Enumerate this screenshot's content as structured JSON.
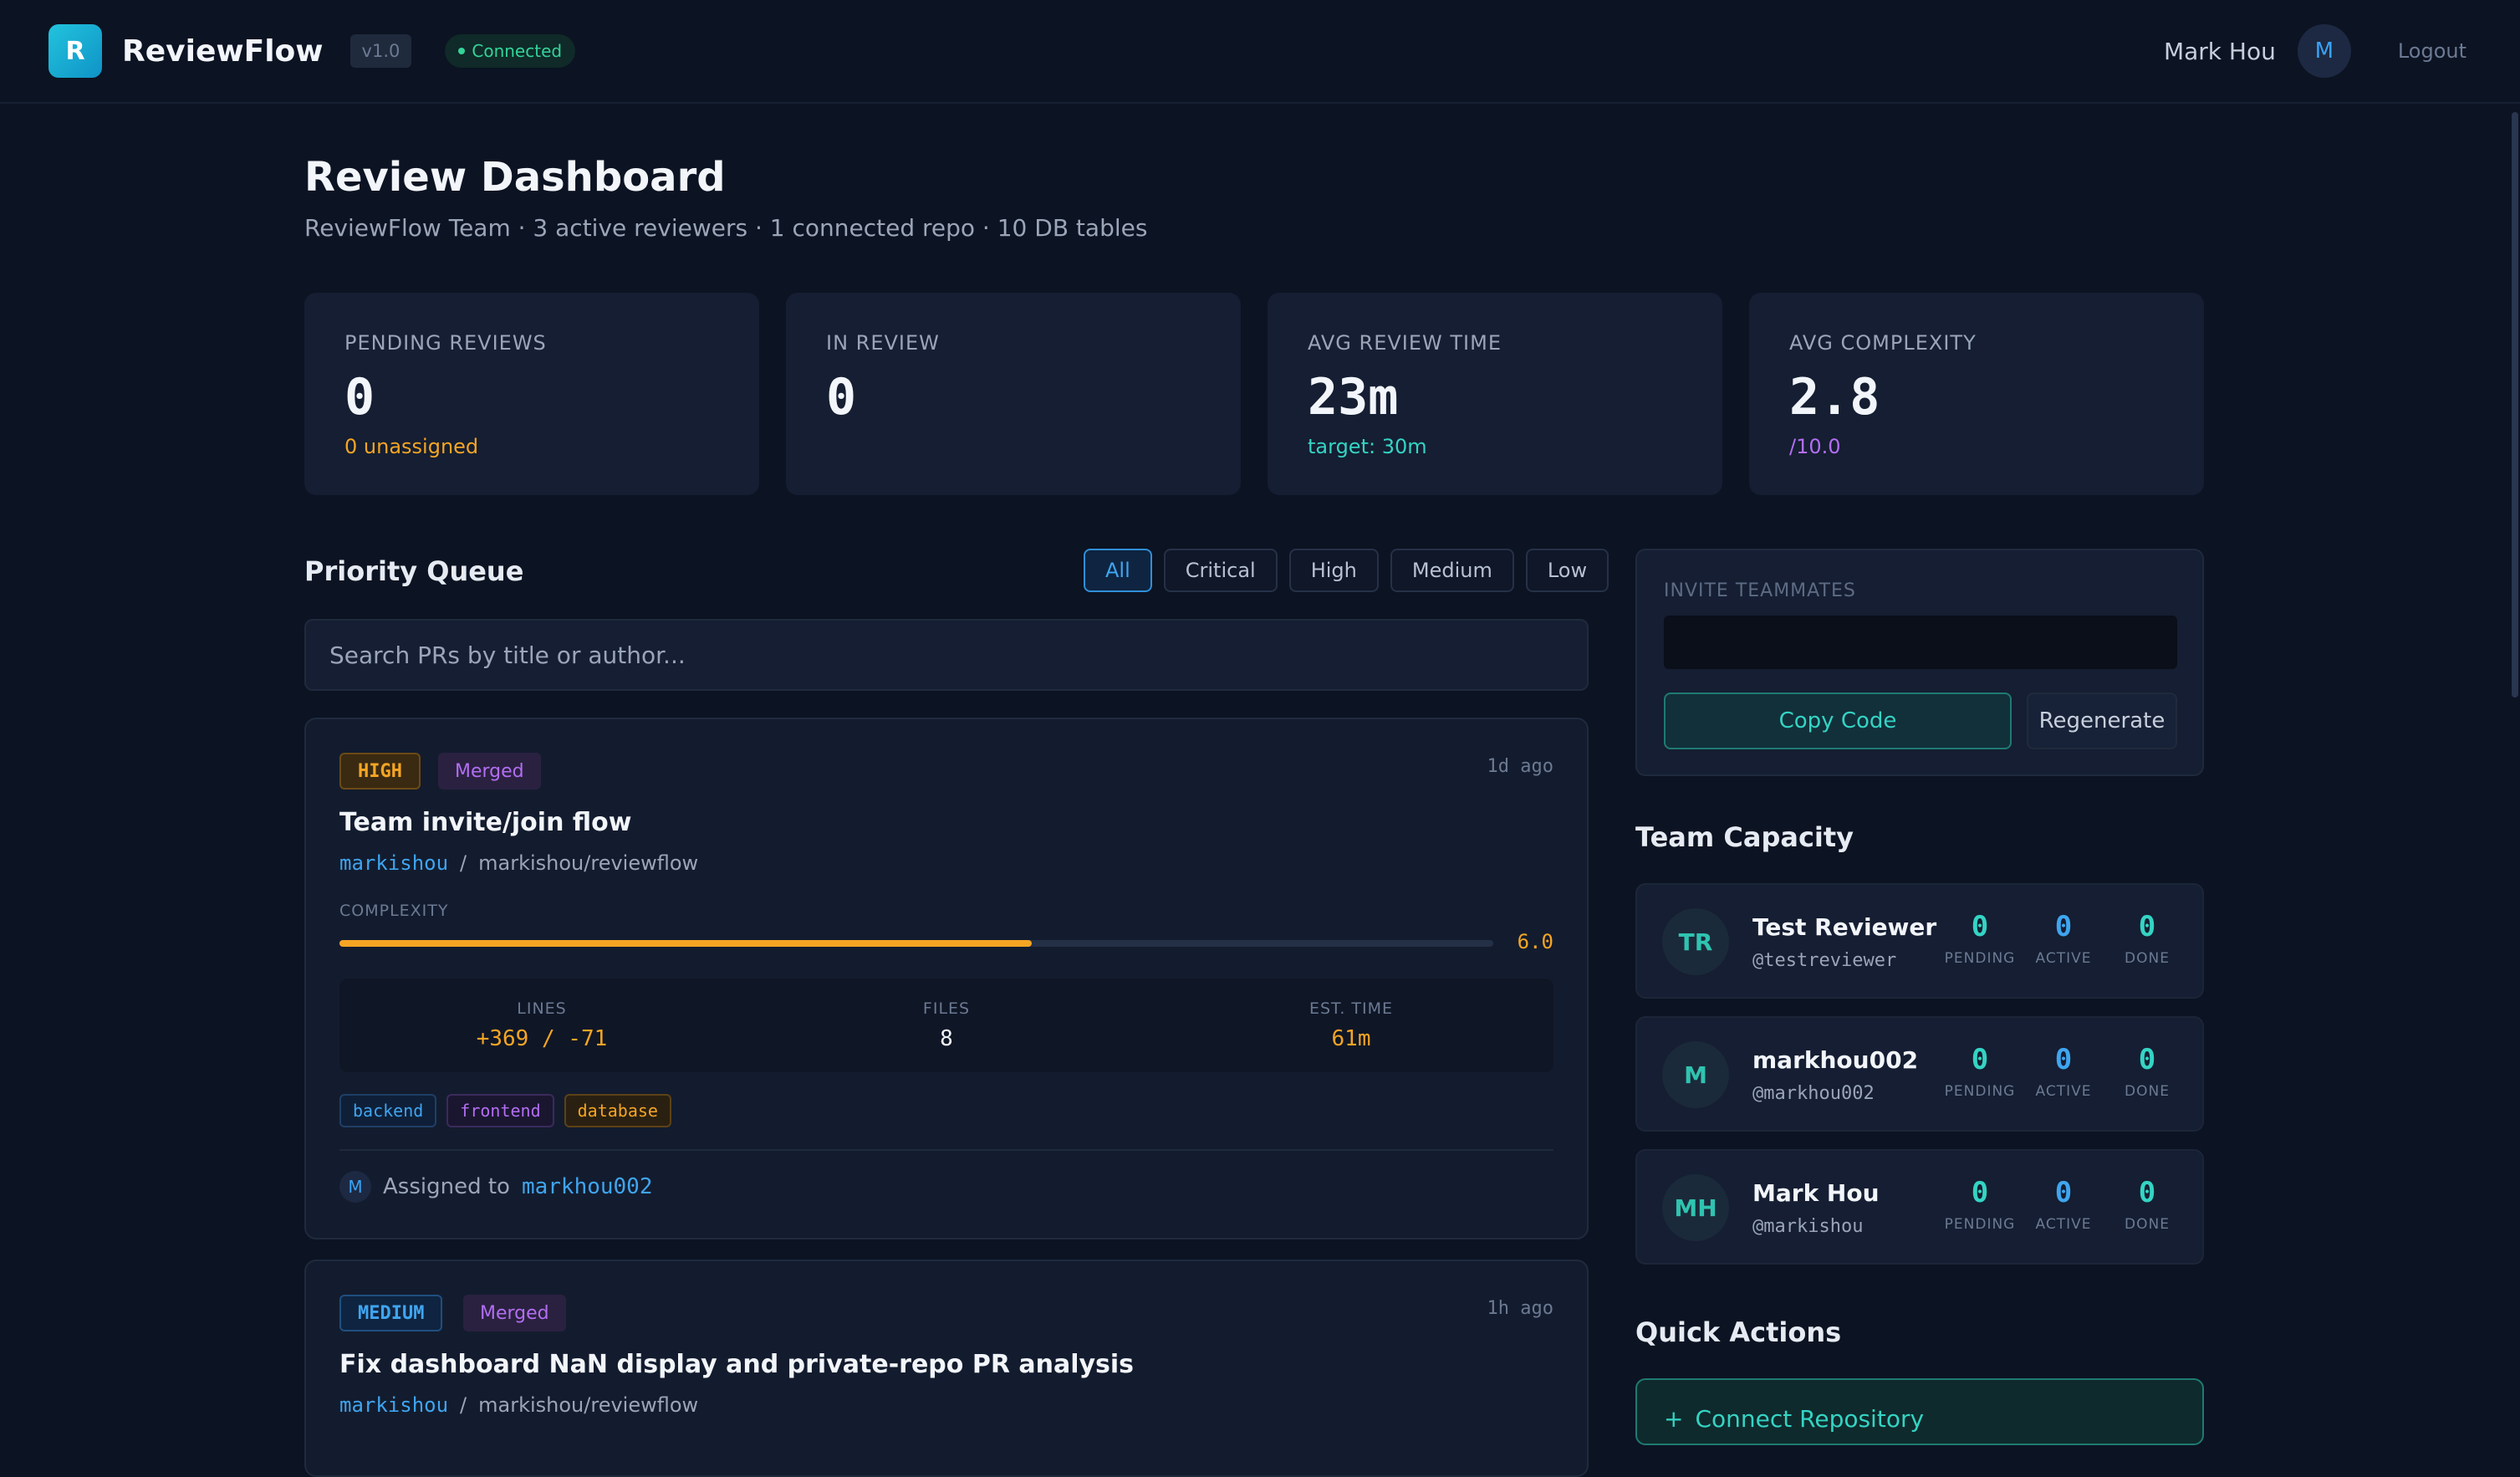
{
  "nav": {
    "logo_letter": "R",
    "brand": "ReviewFlow",
    "version": "v1.0",
    "status": "Connected",
    "user_name": "Mark Hou",
    "user_initial": "M",
    "logout": "Logout"
  },
  "header": {
    "title": "Review Dashboard",
    "subtitle": "ReviewFlow Team · 3 active reviewers · 1 connected repo · 10 DB tables"
  },
  "stats": [
    {
      "label": "PENDING REVIEWS",
      "value": "0",
      "sub": "0 unassigned",
      "sub_color": "#f5a524"
    },
    {
      "label": "IN REVIEW",
      "value": "0",
      "sub": "",
      "sub_color": "#9aa5b8"
    },
    {
      "label": "AVG REVIEW TIME",
      "value": "23m",
      "sub": "target: 30m",
      "sub_color": "#34d4c4"
    },
    {
      "label": "AVG COMPLEXITY",
      "value": "2.8",
      "sub": "/10.0",
      "sub_color": "#b36ef2"
    }
  ],
  "queue": {
    "title": "Priority Queue",
    "filters": [
      "All",
      "Critical",
      "High",
      "Medium",
      "Low"
    ],
    "active_filter": "All",
    "search_placeholder": "Search PRs by title or author...",
    "prs": [
      {
        "priority": "HIGH",
        "status": "Merged",
        "time": "1d ago",
        "title": "Team invite/join flow",
        "author": "markishou",
        "separator": "/",
        "repo": "markishou/reviewflow",
        "complexity_label": "COMPLEXITY",
        "complexity": 6.0,
        "complexity_text": "6.0",
        "complexity_max": 10,
        "metrics": [
          {
            "label": "LINES",
            "value": "+369 / -71",
            "color": "#f5a524"
          },
          {
            "label": "FILES",
            "value": "8",
            "color": "#f2f5fa"
          },
          {
            "label": "EST. TIME",
            "value": "61m",
            "color": "#f5a524"
          }
        ],
        "tags": [
          "backend",
          "frontend",
          "database"
        ],
        "assigned_initial": "M",
        "assigned_prefix": "Assigned to",
        "assigned_to": "markhou002"
      },
      {
        "priority": "MEDIUM",
        "status": "Merged",
        "time": "1h ago",
        "title": "Fix dashboard NaN display and private-repo PR analysis",
        "author": "markishou",
        "separator": "/",
        "repo": "markishou/reviewflow"
      }
    ]
  },
  "invite": {
    "label": "INVITE TEAMMATES",
    "code": "",
    "copy": "Copy Code",
    "regenerate": "Regenerate"
  },
  "capacity": {
    "title": "Team Capacity",
    "stat_labels": [
      "PENDING",
      "ACTIVE",
      "DONE"
    ],
    "members": [
      {
        "initials": "TR",
        "name": "Test Reviewer",
        "handle": "@testreviewer",
        "pending": "0",
        "active": "0",
        "done": "0"
      },
      {
        "initials": "M",
        "name": "markhou002",
        "handle": "@markhou002",
        "pending": "0",
        "active": "0",
        "done": "0"
      },
      {
        "initials": "MH",
        "name": "Mark Hou",
        "handle": "@markishou",
        "pending": "0",
        "active": "0",
        "done": "0"
      }
    ]
  },
  "quick_actions": {
    "title": "Quick Actions",
    "items": [
      {
        "icon": "+",
        "label": "Connect Repository"
      }
    ]
  },
  "colors": {
    "accent_blue": "#3fa5f0",
    "accent_teal": "#34d4c4",
    "warning": "#f5a524",
    "purple": "#b36ef2",
    "background": "#0c1322"
  }
}
